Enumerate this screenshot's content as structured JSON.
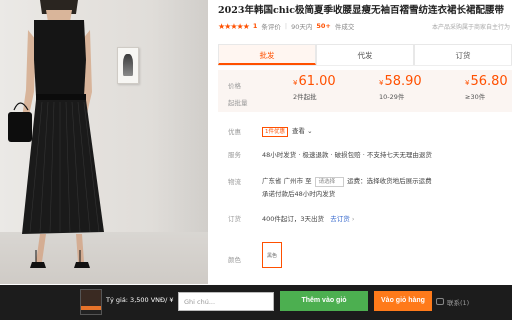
{
  "product": {
    "title": "2023年韩国chic极简夏季收腰显瘦无袖百褶雪纺连衣裙长裙配腰带",
    "stars": "★★★★★",
    "rating_count": "1",
    "rating_label": "条评价",
    "sales_prefix": "90天内",
    "sales_count": "50+",
    "sales_suffix": "件成交",
    "right_note": "本产品采购属于商家自主行为"
  },
  "tabs": [
    {
      "label": "批发",
      "active": true
    },
    {
      "label": "代发",
      "active": false
    },
    {
      "label": "订货",
      "active": false
    }
  ],
  "prices": {
    "price_label": "价格",
    "qty_label": "起批量",
    "tiers": [
      {
        "currency": "¥",
        "value": "61.00",
        "qty": "2件起批"
      },
      {
        "currency": "¥",
        "value": "58.90",
        "qty": "10-29件"
      },
      {
        "currency": "¥",
        "value": "56.80",
        "qty": "≥30件"
      }
    ]
  },
  "promo": {
    "label": "优惠",
    "badge": "1件优惠",
    "text": "查看"
  },
  "service": {
    "label": "服务",
    "text": "48小时发货 · 极速退款 · 破损包赔 · 不支持七天无理由退货"
  },
  "logistics": {
    "label": "物流",
    "from": "广东省 广州市 至",
    "dropdown": "请选择",
    "freight": "运费：选择收货地后展示运费",
    "line2": "承诺付款后48小时内发货"
  },
  "order": {
    "label": "订货",
    "text": "400件起订，3天出货",
    "link": "去订货"
  },
  "color": {
    "label": "颜色",
    "swatch": "黑色"
  },
  "bar": {
    "rate": "Tỷ giá: 3,500 VNĐ/ ¥",
    "note_placeholder": "Ghi chú...",
    "add_label": "Thêm vào giỏ",
    "cart_label": "Vào giỏ hàng",
    "chat_label": "联系(1)"
  },
  "colors": {
    "accent": "#ff5000",
    "bar_bg": "#1c1c1c",
    "add_btn": "#4caf50",
    "cart_btn": "#ff7a1a"
  }
}
